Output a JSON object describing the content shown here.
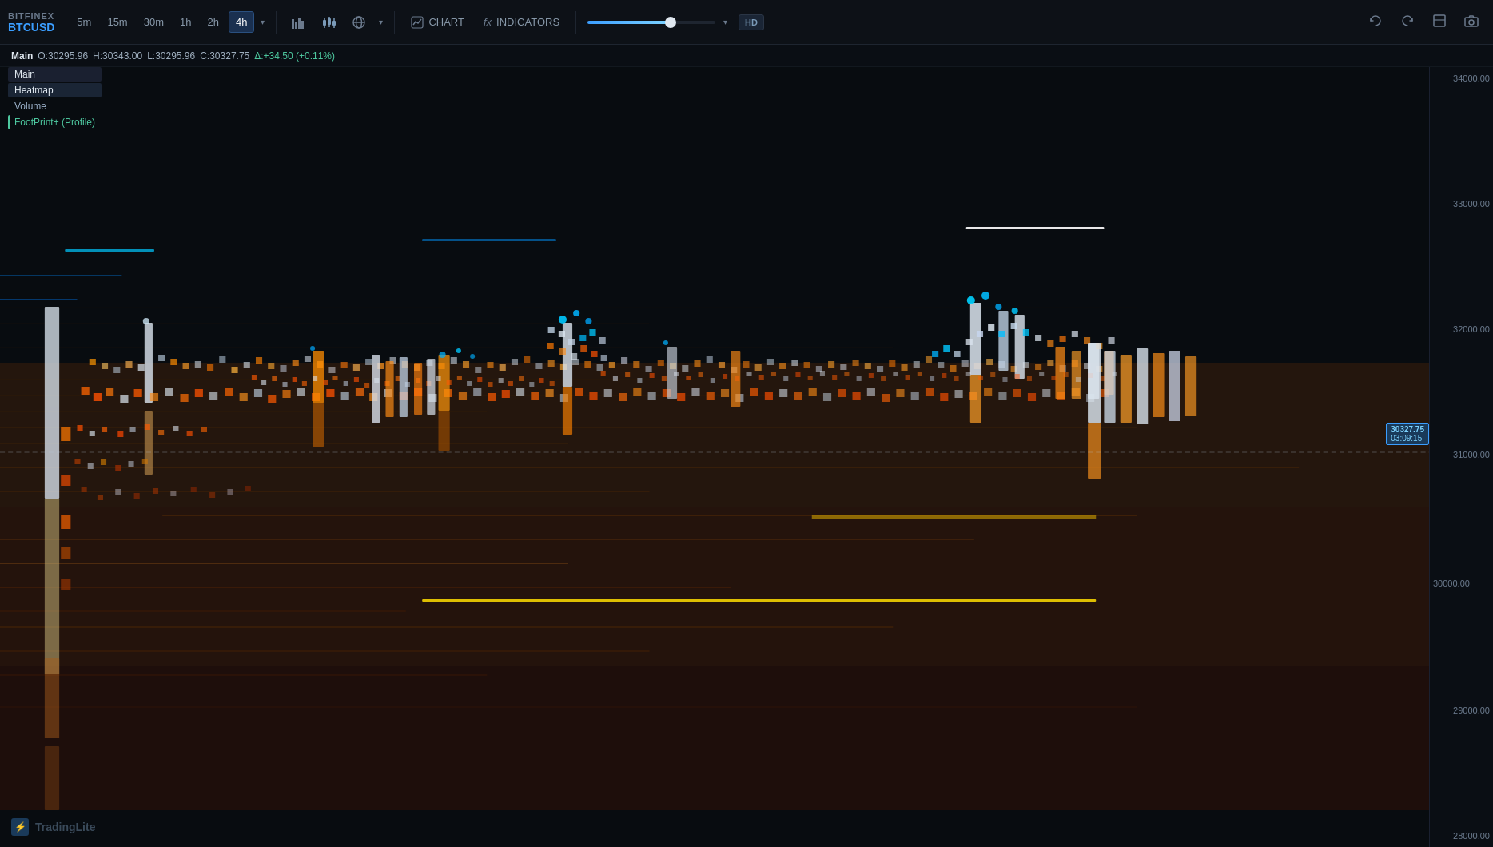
{
  "brand": {
    "exchange": "BITFINEX",
    "pair": "BTCUSD"
  },
  "toolbar": {
    "timeframes": [
      "5m",
      "15m",
      "30m",
      "1h",
      "2h",
      "4h"
    ],
    "active_timeframe": "4h",
    "chart_label": "CHART",
    "indicators_label": "INDICATORS",
    "hd_label": "HD"
  },
  "ohlc": {
    "label": "Main",
    "open": "O:30295.96",
    "high": "H:30343.00",
    "low": "L:30295.96",
    "close": "C:30327.75",
    "delta": "Δ:+34.50 (+0.11%)"
  },
  "legend": {
    "main_label": "Main",
    "heatmap_label": "Heatmap",
    "volume_label": "Volume",
    "footprint_label": "FootPrint+ (Profile)"
  },
  "price_axis": {
    "levels": [
      "34000.00",
      "33000.00",
      "32000.00",
      "31000.00",
      "30000.00",
      "29000.00",
      "28000.00"
    ]
  },
  "current_price": {
    "price": "30327.75",
    "time": "03:09:15"
  },
  "watermark": {
    "text": "TradingLite"
  }
}
